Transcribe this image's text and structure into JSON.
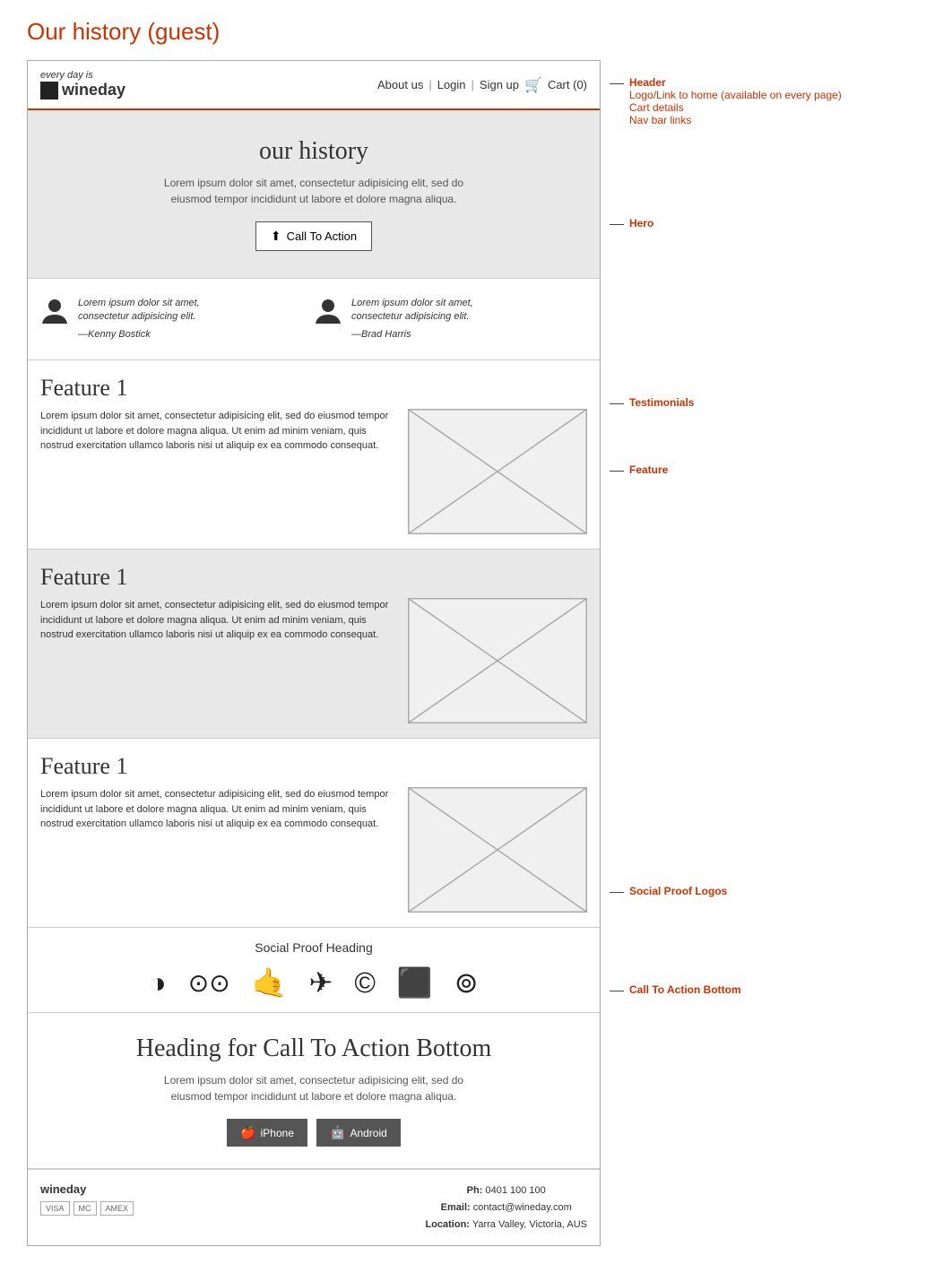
{
  "page": {
    "title": "Our history (guest)"
  },
  "header": {
    "tagline": "every day is",
    "brand": "wineday",
    "nav": {
      "about": "About us",
      "login": "Login",
      "signup": "Sign up",
      "cart": "Cart (0)"
    },
    "annotation": {
      "line1": "Header",
      "line2": "Logo/Link to home (available on every page)",
      "line3": "Cart details",
      "line4": "Nav bar links"
    }
  },
  "hero": {
    "title": "our history",
    "subtitle": "Lorem ipsum dolor sit amet, consectetur adipisicing elit, sed do eiusmod tempor incididunt ut labore et dolore magna aliqua.",
    "cta_label": "Call To Action",
    "annotation": "Hero"
  },
  "testimonials": {
    "annotation": "Testimonials",
    "items": [
      {
        "text": "Lorem ipsum dolor sit amet, consectetur adipisicing elit.",
        "author": "—Kenny Bostick"
      },
      {
        "text": "Lorem ipsum dolor sit amet, consectetur adipisicing elit.",
        "author": "—Brad Harris"
      }
    ]
  },
  "features": {
    "annotation": "Feature",
    "items": [
      {
        "heading": "Feature 1",
        "text": "Lorem ipsum dolor sit amet, consectetur adipisicing elit, sed do eiusmod tempor incididunt ut labore et dolore magna aliqua. Ut enim ad minim veniam, quis nostrud exercitation ullamco laboris nisi ut aliquip ex ea commodo consequat."
      },
      {
        "heading": "Feature 1",
        "text": "Lorem ipsum dolor sit amet, consectetur adipisicing elit, sed do eiusmod tempor incididunt ut labore et dolore magna aliqua. Ut enim ad minim veniam, quis nostrud exercitation ullamco laboris nisi ut aliquip ex ea commodo consequat."
      },
      {
        "heading": "Feature 1",
        "text": "Lorem ipsum dolor sit amet, consectetur adipisicing elit, sed do eiusmod tempor incididunt ut labore et dolore magna aliqua. Ut enim ad minim veniam, quis nostrud exercitation ullamco laboris nisi ut aliquip ex ea commodo consequat."
      }
    ]
  },
  "social_proof": {
    "heading": "Social Proof Heading",
    "annotation": "Social Proof Logos",
    "logos": [
      "◑",
      "⊙",
      "☞",
      "✈",
      "©",
      "⬛",
      "⊚"
    ]
  },
  "cta_bottom": {
    "annotation": "Call To Action Bottom",
    "heading": "Heading for Call To Action Bottom",
    "subtitle": "Lorem ipsum dolor sit amet, consectetur adipisicing elit, sed do eiusmod tempor incididunt ut labore et dolore magna aliqua.",
    "iphone_label": "iPhone",
    "android_label": "Android"
  },
  "footer": {
    "brand": "wineday",
    "payment_icons": [
      "VISA",
      "MC",
      "AMEX"
    ],
    "phone_label": "Ph:",
    "phone_value": "0401 100 100",
    "email_label": "Email:",
    "email_value": "contact@wineday.com",
    "location_label": "Location:",
    "location_value": "Yarra Valley, Victoria, AUS"
  }
}
